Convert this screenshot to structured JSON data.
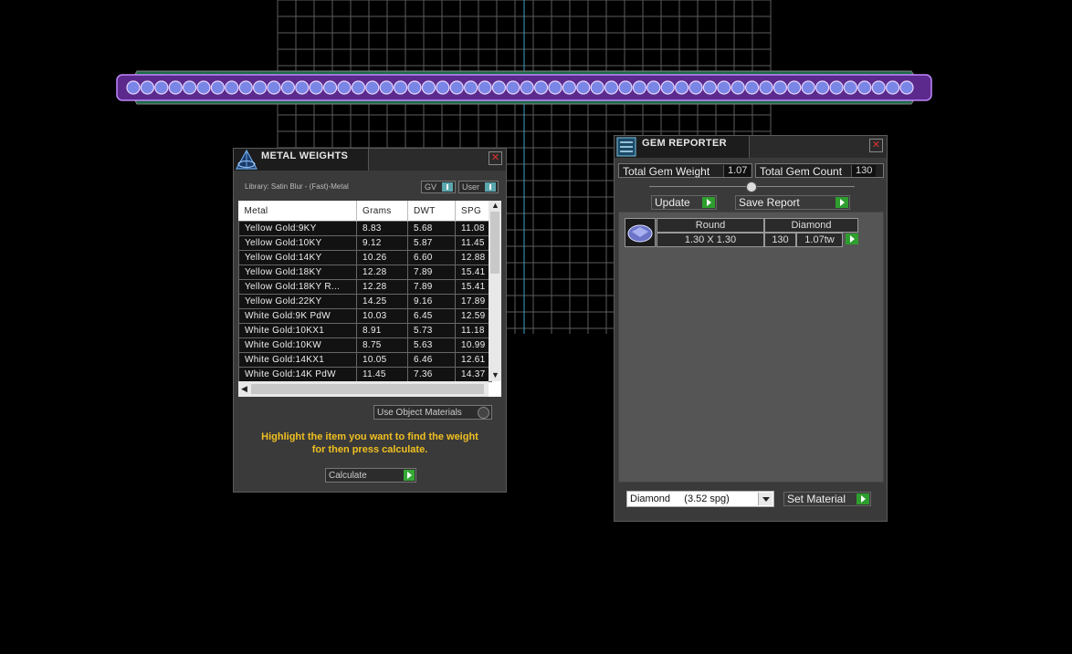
{
  "metal_weights": {
    "title": "METAL WEIGHTS",
    "library": "Library: Satin Blur - (Fast)-Metal",
    "toggles": {
      "gv": "GV",
      "user": "User"
    },
    "columns": [
      "Metal",
      "Grams",
      "DWT",
      "SPG"
    ],
    "rows": [
      [
        "Yellow Gold:9KY",
        "8.83",
        "5.68",
        "11.08"
      ],
      [
        "Yellow Gold:10KY",
        "9.12",
        "5.87",
        "11.45"
      ],
      [
        "Yellow Gold:14KY",
        "10.26",
        "6.60",
        "12.88"
      ],
      [
        "Yellow Gold:18KY",
        "12.28",
        "7.89",
        "15.41"
      ],
      [
        "Yellow Gold:18KY R...",
        "12.28",
        "7.89",
        "15.41"
      ],
      [
        "Yellow Gold:22KY",
        "14.25",
        "9.16",
        "17.89"
      ],
      [
        "White Gold:9K PdW",
        "10.03",
        "6.45",
        "12.59"
      ],
      [
        "White Gold:10KX1",
        "8.91",
        "5.73",
        "11.18"
      ],
      [
        "White Gold:10KW",
        "8.75",
        "5.63",
        "10.99"
      ],
      [
        "White Gold:14KX1",
        "10.05",
        "6.46",
        "12.61"
      ],
      [
        "White Gold:14K PdW",
        "11.45",
        "7.36",
        "14.37"
      ]
    ],
    "use_object_materials": "Use Object Materials",
    "hint_line1": "Highlight the item you want to find the weight",
    "hint_line2": "for then press calculate.",
    "calculate_label": "Calculate"
  },
  "gem_reporter": {
    "title": "GEM REPORTER",
    "total_gem_weight_label": "Total Gem Weight",
    "total_gem_weight_value": "1.07",
    "total_gem_count_label": "Total Gem Count",
    "total_gem_count_value": "130",
    "update_label": "Update",
    "save_report_label": "Save Report",
    "gem": {
      "shape": "Round",
      "material": "Diamond",
      "size": "1.30 X 1.30",
      "count": "130",
      "weight": "1.07tw"
    },
    "material_select": "Diamond     (3.52 spg)",
    "set_material_label": "Set Material"
  },
  "colors": {
    "hint": "#f0c020",
    "go_button": "#35a835",
    "gem_purple": "#9a62e8",
    "band_green": "#1e7a4e"
  },
  "icons": [
    "metal-weights-icon",
    "gem-reporter-icon",
    "close-icon",
    "play-arrow-icon",
    "dropdown-arrow-icon"
  ]
}
